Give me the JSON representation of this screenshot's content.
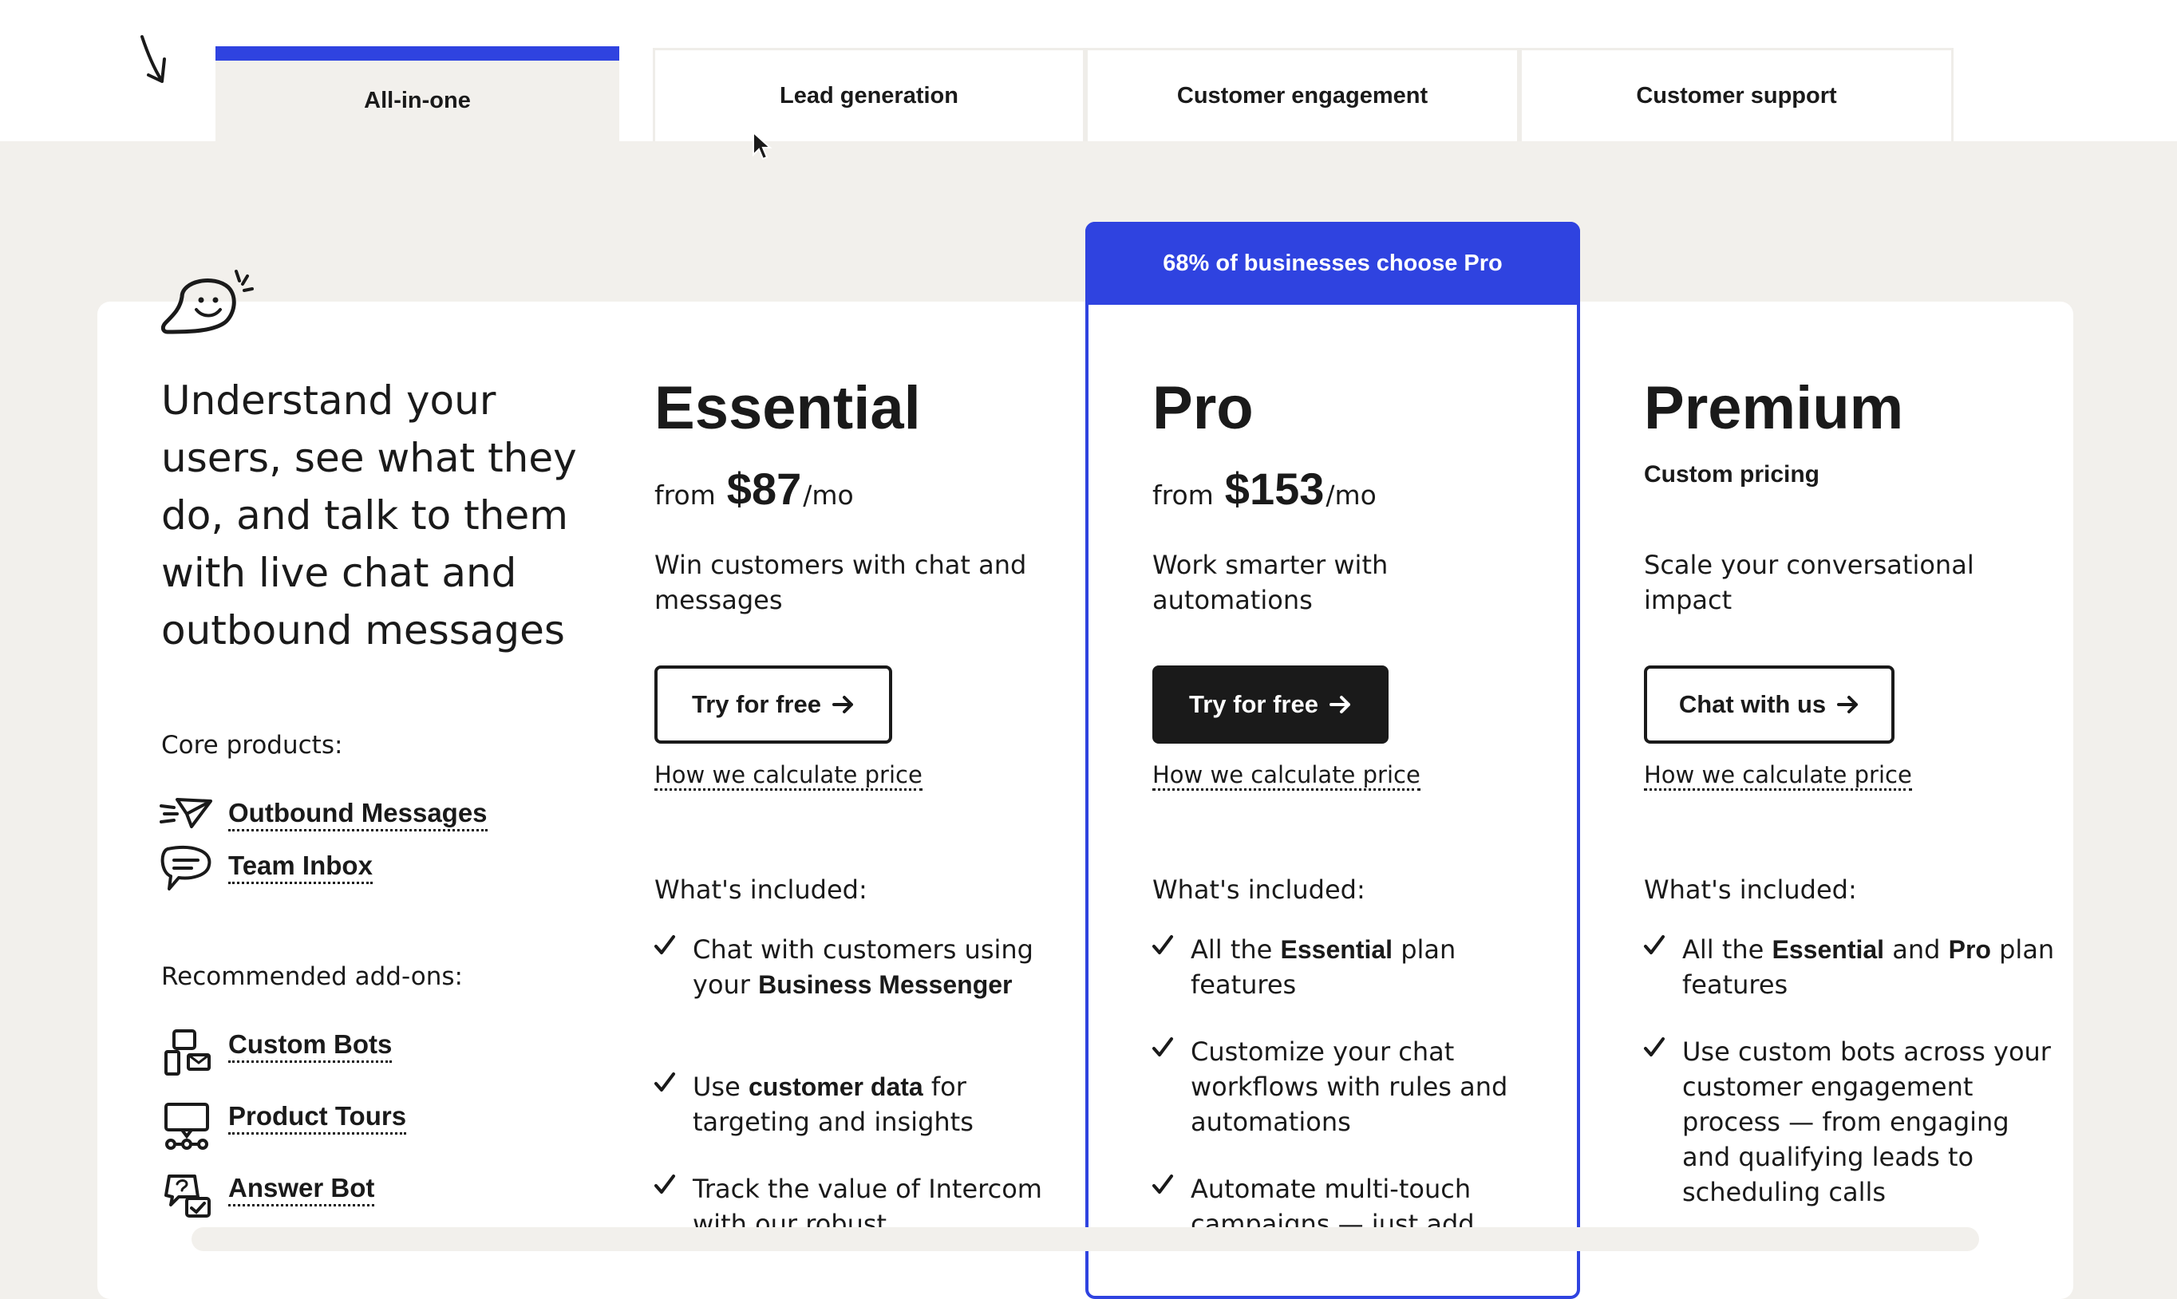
{
  "tabs": [
    {
      "label": "All-in-one",
      "active": true
    },
    {
      "label": "Lead generation",
      "active": false
    },
    {
      "label": "Customer engagement",
      "active": false
    },
    {
      "label": "Customer support",
      "active": false
    }
  ],
  "banner": {
    "label": "68% of businesses choose Pro"
  },
  "intro": {
    "headline": "Understand your users, see what they do, and talk to them with live chat and outbound messages",
    "core_label": "Core products:",
    "core_products": [
      "Outbound Messages",
      "Team Inbox"
    ],
    "addons_label": "Recommended add-ons:",
    "addons": [
      "Custom Bots",
      "Product Tours",
      "Answer Bot"
    ]
  },
  "plans": {
    "essential": {
      "name": "Essential",
      "from": "from",
      "price": "$87",
      "per": "/mo",
      "tagline": "Win customers with chat and messages",
      "cta": "Try for free",
      "calc": "How we calculate price",
      "included": "What's included:",
      "features": [
        {
          "a": "Chat with customers using your ",
          "b": "Business Messenger",
          "c": ""
        },
        {
          "a": "Use ",
          "b": "customer data",
          "c": " for targeting and insights"
        },
        {
          "a": "Track the value of Intercom with our robust",
          "b": "",
          "c": ""
        }
      ]
    },
    "pro": {
      "name": "Pro",
      "from": "from",
      "price": "$153",
      "per": "/mo",
      "tagline": "Work smarter with automations",
      "cta": "Try for free",
      "calc": "How we calculate price",
      "included": "What's included:",
      "features": [
        {
          "a": "All the ",
          "b": "Essential",
          "c": " plan features"
        },
        {
          "a": "Customize your chat workflows with rules and automations",
          "b": "",
          "c": ""
        },
        {
          "a": "Automate multi-touch campaigns — just add",
          "b": "",
          "c": ""
        }
      ]
    },
    "premium": {
      "name": "Premium",
      "custom_price": "Custom pricing",
      "tagline": "Scale your conversational impact",
      "cta": "Chat with us",
      "calc": "How we calculate price",
      "included": "What's included:",
      "features": [
        {
          "a": "All the ",
          "b": "Essential",
          "c": " and ",
          "d": "Pro",
          "e": " plan features"
        },
        {
          "a": "Use custom bots across your customer engagement process — from engaging and qualifying leads to scheduling calls",
          "b": "",
          "c": ""
        }
      ]
    }
  },
  "colors": {
    "accent": "#2f43e0",
    "ink": "#1a1a1a",
    "background": "#f2f0ec"
  }
}
